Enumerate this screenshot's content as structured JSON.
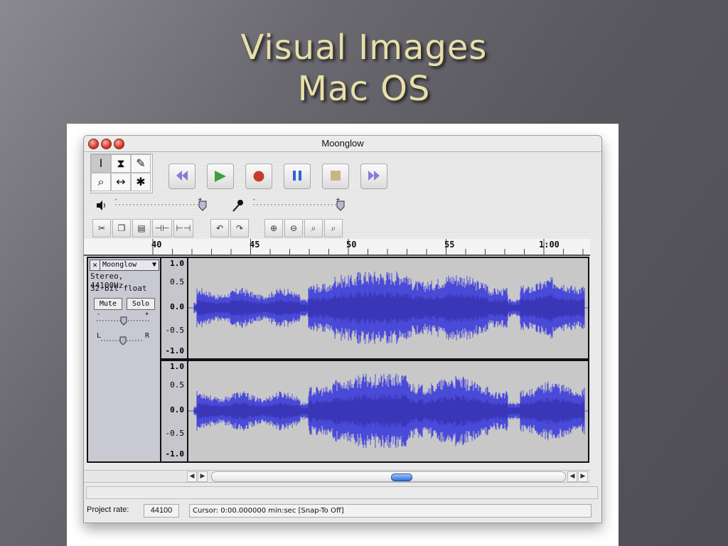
{
  "slide": {
    "title_line1": "Visual Images",
    "title_line2": "Mac OS"
  },
  "window": {
    "title": "Moonglow"
  },
  "tools": {
    "selection": "I",
    "envelope": "⧗",
    "draw": "✎",
    "zoom": "⌕",
    "timeshift": "↔",
    "multi": "✱"
  },
  "transport": [
    "skip-to-start",
    "play",
    "record",
    "pause",
    "stop",
    "skip-to-end"
  ],
  "colors": {
    "waveform": "#4a4ad8",
    "waveform_dark": "#3a36b8",
    "play": "#3ca03c",
    "record": "#c83a2a",
    "pause": "#2f62d8",
    "stop": "#c9b48a",
    "skip": "#8a7ad8"
  },
  "ruler": {
    "ticks": [
      "40",
      "45",
      "50",
      "55",
      "1:00"
    ]
  },
  "track": {
    "name": "Moonglow",
    "format": "Stereo, 44100Hz",
    "bitdepth": "32-bit float",
    "mute": "Mute",
    "solo": "Solo",
    "gain_minus": "-",
    "gain_plus": "+",
    "pan_left": "L",
    "pan_right": "R",
    "scale": [
      "1.0",
      "0.5",
      "0.0",
      "-0.5",
      "-1.0"
    ]
  },
  "status": {
    "rate_label": "Project rate:",
    "rate_value": "44100",
    "cursor_text": "Cursor: 0:00.000000 min:sec   [Snap-To Off]"
  }
}
